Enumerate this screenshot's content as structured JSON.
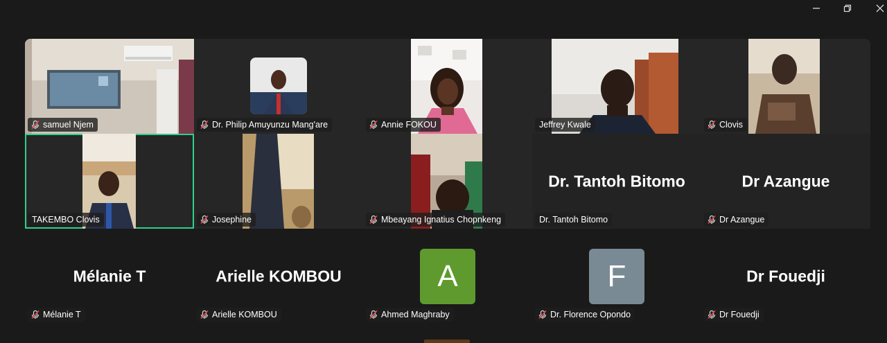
{
  "window": {
    "minimize_icon": "minimize-icon",
    "restore_icon": "restore-icon",
    "close_icon": "close-icon"
  },
  "colors": {
    "active_speaker": "#2fd08b",
    "muted_mic": "#e5484d",
    "avatar_a": "#5e9a2e",
    "avatar_f": "#7a8a94"
  },
  "participants": [
    {
      "name": "samuel Njem",
      "muted": true
    },
    {
      "name": "Dr. Philip Amuyunzu Mang'are",
      "muted": true
    },
    {
      "name": "Annie FOKOU",
      "muted": true
    },
    {
      "name": "Jeffrey Kwale",
      "muted": false
    },
    {
      "name": "Clovis",
      "muted": true
    },
    {
      "name": "TAKEMBO Clovis",
      "muted": false,
      "active": true
    },
    {
      "name": "Josephine",
      "muted": true
    },
    {
      "name": "Mbeayang Ignatius Chopnkeng",
      "muted": true
    },
    {
      "name": "Dr. Tantoh Bitomo",
      "muted": false,
      "display": "Dr. Tantoh Bitomo"
    },
    {
      "name": "Dr Azangue",
      "muted": true,
      "display": "Dr Azangue"
    },
    {
      "name": "Mélanie T",
      "muted": true,
      "display": "Mélanie T"
    },
    {
      "name": "Arielle KOMBOU",
      "muted": true,
      "display": "Arielle KOMBOU"
    },
    {
      "name": "Ahmed Maghraby",
      "muted": true,
      "avatar_letter": "A"
    },
    {
      "name": "Dr. Florence Opondo",
      "muted": true,
      "avatar_letter": "F"
    },
    {
      "name": "Dr Fouedji",
      "muted": true,
      "display": "Dr Fouedji"
    }
  ]
}
